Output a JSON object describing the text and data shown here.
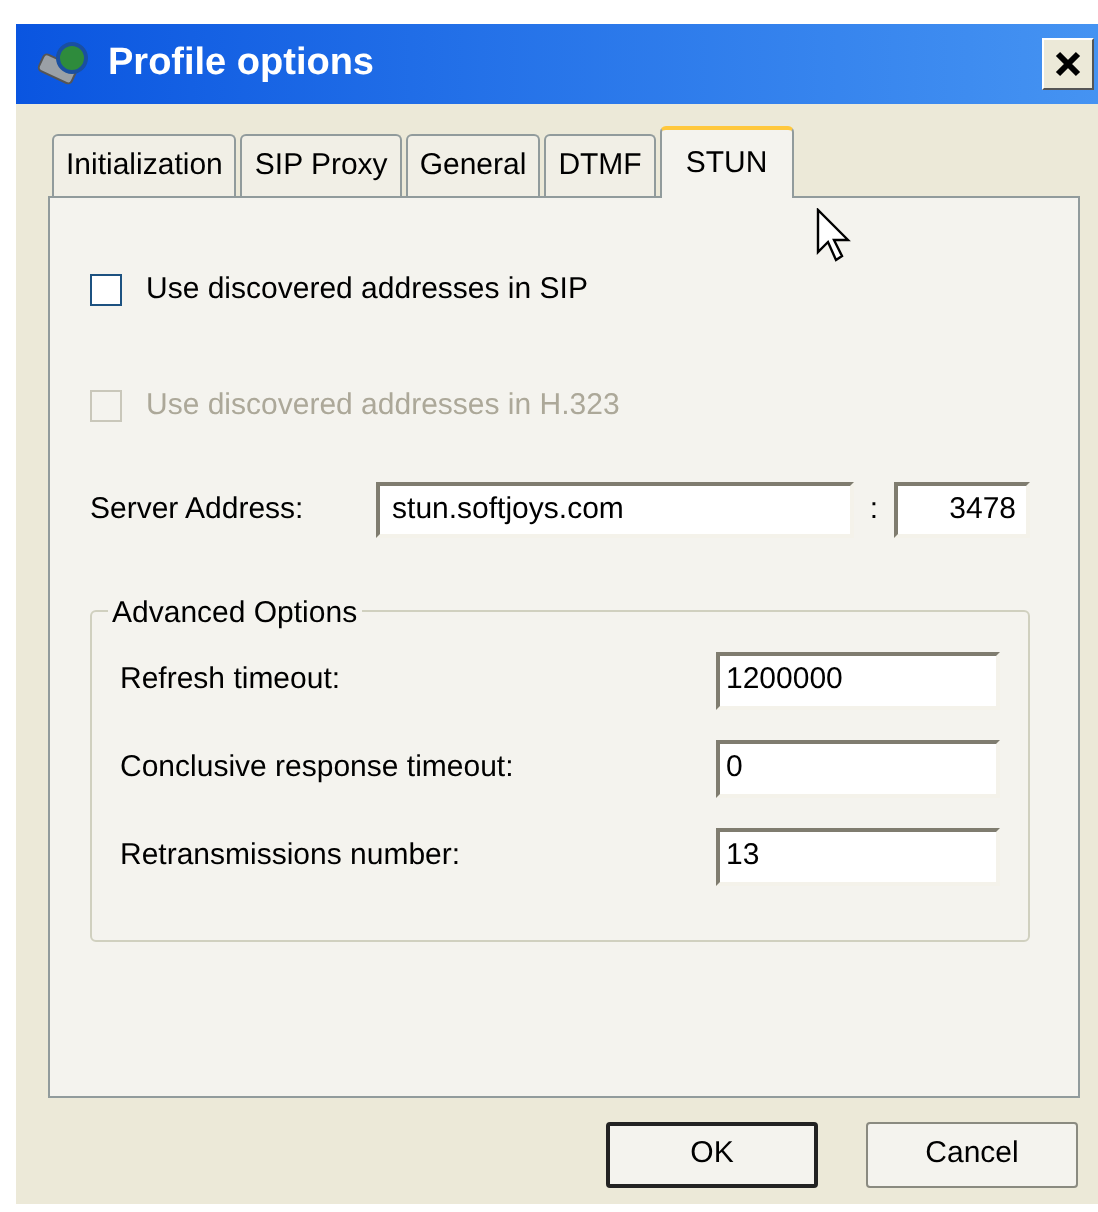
{
  "window": {
    "title": "Profile options"
  },
  "tabs": [
    {
      "label": "Initialization",
      "selected": false
    },
    {
      "label": "SIP Proxy",
      "selected": false
    },
    {
      "label": "General",
      "selected": false
    },
    {
      "label": "DTMF",
      "selected": false
    },
    {
      "label": "STUN",
      "selected": true
    }
  ],
  "checkboxes": [
    {
      "label": "Use discovered addresses in SIP",
      "checked": false,
      "disabled": false
    },
    {
      "label": "Use discovered addresses in H.323",
      "checked": false,
      "disabled": true
    }
  ],
  "server": {
    "label": "Server Address:",
    "value": "stun.softjoys.com",
    "separator": ":",
    "port": "3478"
  },
  "advanced": {
    "title": "Advanced Options",
    "fields": [
      {
        "label": "Refresh timeout:",
        "value": "1200000"
      },
      {
        "label": "Conclusive response timeout:",
        "value": "0"
      },
      {
        "label": "Retransmissions number:",
        "value": "13"
      }
    ]
  },
  "buttons": [
    {
      "label": "OK",
      "default": true
    },
    {
      "label": "Cancel",
      "default": false
    }
  ]
}
